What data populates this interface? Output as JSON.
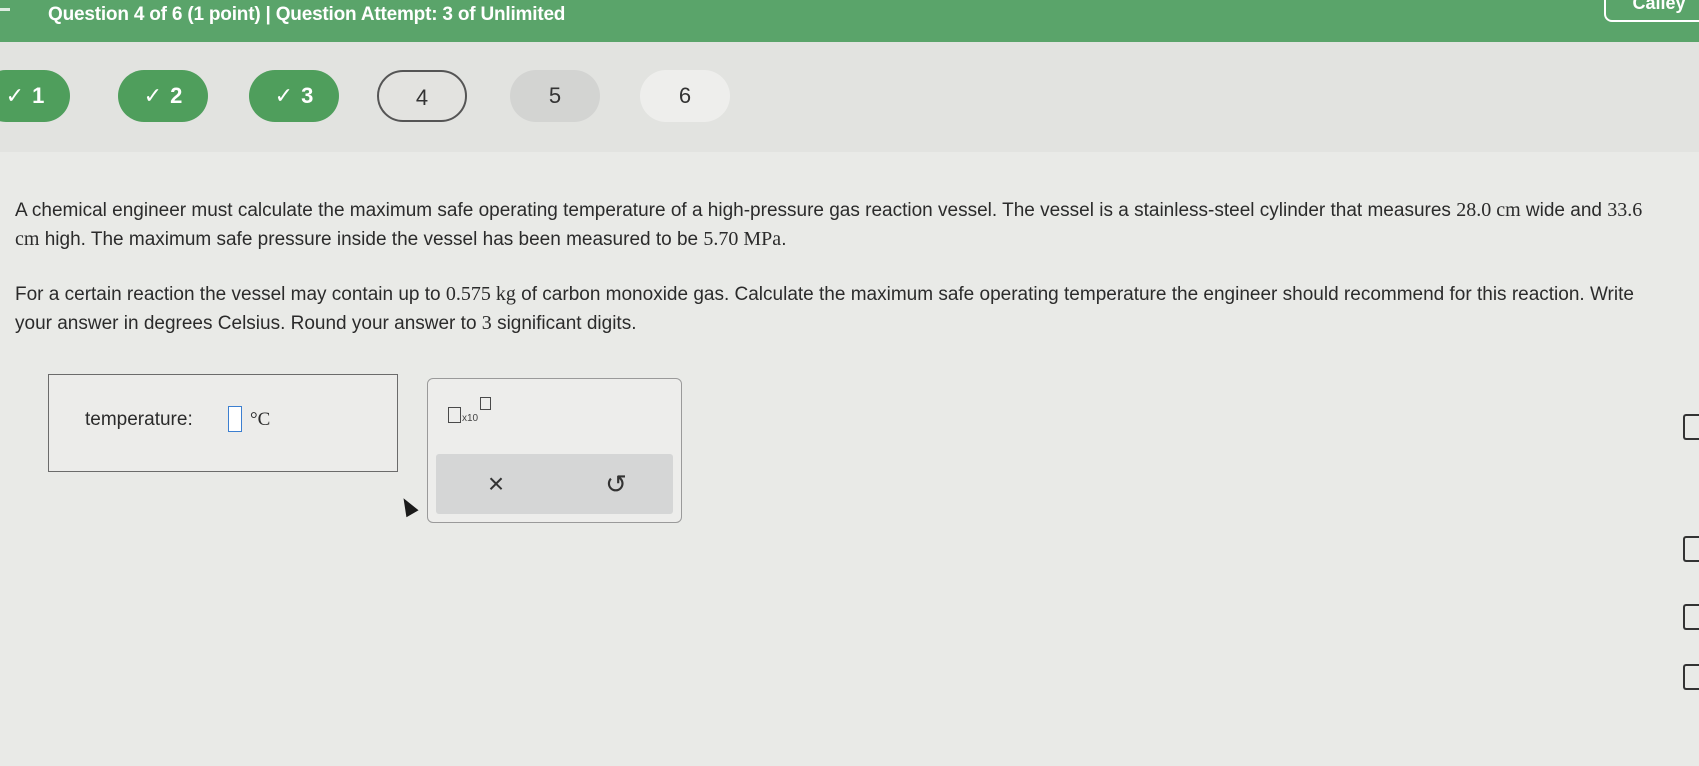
{
  "header": {
    "title": "Question 4 of 6 (1 point)  |  Question Attempt: 3 of Unlimited",
    "user_button": "Calley"
  },
  "question_nav": {
    "items": [
      {
        "label": "1",
        "state": "complete",
        "icon": "check-icon"
      },
      {
        "label": "2",
        "state": "complete",
        "icon": "check-icon"
      },
      {
        "label": "3",
        "state": "complete",
        "icon": "check-icon"
      },
      {
        "label": "4",
        "state": "current"
      },
      {
        "label": "5",
        "state": "unanswered"
      },
      {
        "label": "6",
        "state": "unanswered"
      }
    ],
    "check_glyph": "✓"
  },
  "problem": {
    "p1_a": "A chemical engineer must calculate the maximum safe operating temperature of a high-pressure gas reaction vessel. The vessel is a stainless-steel cylinder that measures ",
    "p1_width": "28.0 cm",
    "p1_b": " wide and ",
    "p1_height": "33.6 cm",
    "p1_c": " high. The maximum safe pressure inside the vessel has been measured to be ",
    "p1_pressure": "5.70 MPa",
    "p1_d": ".",
    "p2_a": "For a certain reaction the vessel may contain up to ",
    "p2_mass": "0.575 kg",
    "p2_b": " of carbon monoxide gas. Calculate the maximum safe operating temperature the engineer should recommend for this reaction. Write your answer in degrees Celsius. Round your answer to ",
    "p2_digits": "3",
    "p2_c": " significant digits."
  },
  "answer": {
    "label": "temperature:",
    "value": "",
    "unit": "°C"
  },
  "keypad": {
    "sci_label": "x10",
    "clear_glyph": "×",
    "undo_glyph": "↺"
  },
  "colors": {
    "header_green": "#5aa46a",
    "complete_green": "#4f9e5c",
    "input_border_blue": "#3c7fd0"
  }
}
